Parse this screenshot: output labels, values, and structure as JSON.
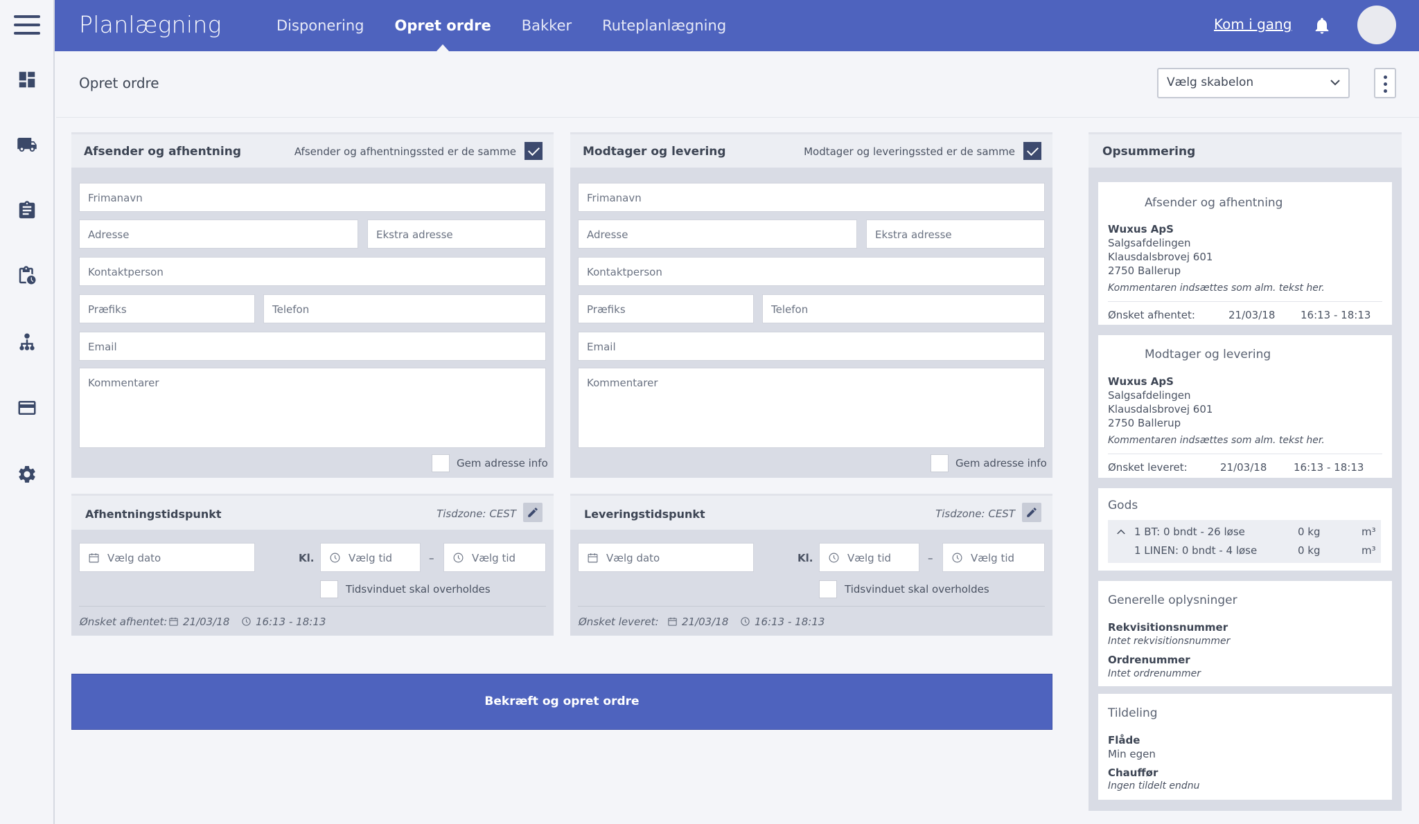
{
  "app": {
    "title": "Planlægning",
    "nav": [
      "Disponering",
      "Opret ordre",
      "Bakker",
      "Ruteplanlægning"
    ],
    "active_nav": "Opret ordre",
    "kom_i_gang": "Kom i gang"
  },
  "sidebar_icons": [
    "dashboard-icon",
    "truck-icon",
    "clipboard-icon",
    "clipboard-clock-icon",
    "hierarchy-icon",
    "card-icon",
    "gear-icon"
  ],
  "page": {
    "title": "Opret ordre",
    "template_select": "Vælg skabelon"
  },
  "sender": {
    "heading": "Afsender og afhentning",
    "same_label": "Afsender og afhentningssted er de samme",
    "same_checked": true,
    "fields": {
      "firm": "Frimanavn",
      "address": "Adresse",
      "extra_address": "Ekstra adresse",
      "contact": "Kontaktperson",
      "prefix": "Præfiks",
      "phone": "Telefon",
      "email": "Email",
      "comments": "Kommentarer"
    },
    "save_label": "Gem adresse info"
  },
  "receiver": {
    "heading": "Modtager og levering",
    "same_label": "Modtager og leveringssted er de samme",
    "same_checked": true,
    "fields": {
      "firm": "Frimanavn",
      "address": "Adresse",
      "extra_address": "Ekstra adresse",
      "contact": "Kontaktperson",
      "prefix": "Præfiks",
      "phone": "Telefon",
      "email": "Email",
      "comments": "Kommentarer"
    },
    "save_label": "Gem adresse info"
  },
  "pickup_time": {
    "heading": "Afhentningstidspunkt",
    "timezone": "Tisdzone: CEST",
    "date_placeholder": "Vælg dato",
    "kl": "Kl.",
    "from_placeholder": "Vælg tid",
    "dash": "–",
    "to_placeholder": "Vælg tid",
    "window_label": "Tidsvinduet skal overholdes",
    "wish_label": "Ønsket afhentet:",
    "wish_date": "21/03/18",
    "wish_time": "16:13 - 18:13"
  },
  "delivery_time": {
    "heading": "Leveringstidspunkt",
    "timezone": "Tisdzone: CEST",
    "date_placeholder": "Vælg dato",
    "kl": "Kl.",
    "from_placeholder": "Vælg tid",
    "dash": "–",
    "to_placeholder": "Vælg tid",
    "window_label": "Tidsvinduet skal overholdes",
    "wish_label": "Ønsket leveret:",
    "wish_date": "21/03/18",
    "wish_time": "16:13 - 18:13"
  },
  "confirm_button": "Bekræft og opret ordre",
  "summary": {
    "heading": "Opsummering",
    "sender": {
      "title": "Afsender og afhentning",
      "company": "Wuxus ApS",
      "dept": "Salgsafdelingen",
      "street": "Klausdalsbrovej 601",
      "city": "2750 Ballerup",
      "comment": "Kommentaren indsættes som alm. tekst her.",
      "wish_label": "Ønsket afhentet:",
      "wish_date": "21/03/18",
      "wish_time": "16:13 - 18:13"
    },
    "receiver": {
      "title": "Modtager og levering",
      "company": "Wuxus ApS",
      "dept": "Salgsafdelingen",
      "street": "Klausdalsbrovej 601",
      "city": "2750 Ballerup",
      "comment": "Kommentaren indsættes som alm. tekst her.",
      "wish_label": "Ønsket leveret:",
      "wish_date": "21/03/18",
      "wish_time": "16:13 - 18:13"
    },
    "goods": {
      "title": "Gods",
      "rows": [
        {
          "desc": "1 BT: 0 bndt - 26 løse",
          "weight": "0 kg",
          "unit": "m³"
        },
        {
          "desc": "1 LINEN: 0 bndt - 4 løse",
          "weight": "0 kg",
          "unit": "m³"
        }
      ]
    },
    "general": {
      "title": "Generelle oplysninger",
      "req_label": "Rekvisitionsnummer",
      "req_value": "Intet rekvisitionsnummer",
      "order_label": "Ordrenummer",
      "order_value": "Intet ordrenummer"
    },
    "assignment": {
      "title": "Tildeling",
      "fleet_label": "Flåde",
      "fleet_value": "Min egen",
      "driver_label": "Chauffør",
      "driver_value": "Ingen tildelt endnu"
    }
  }
}
